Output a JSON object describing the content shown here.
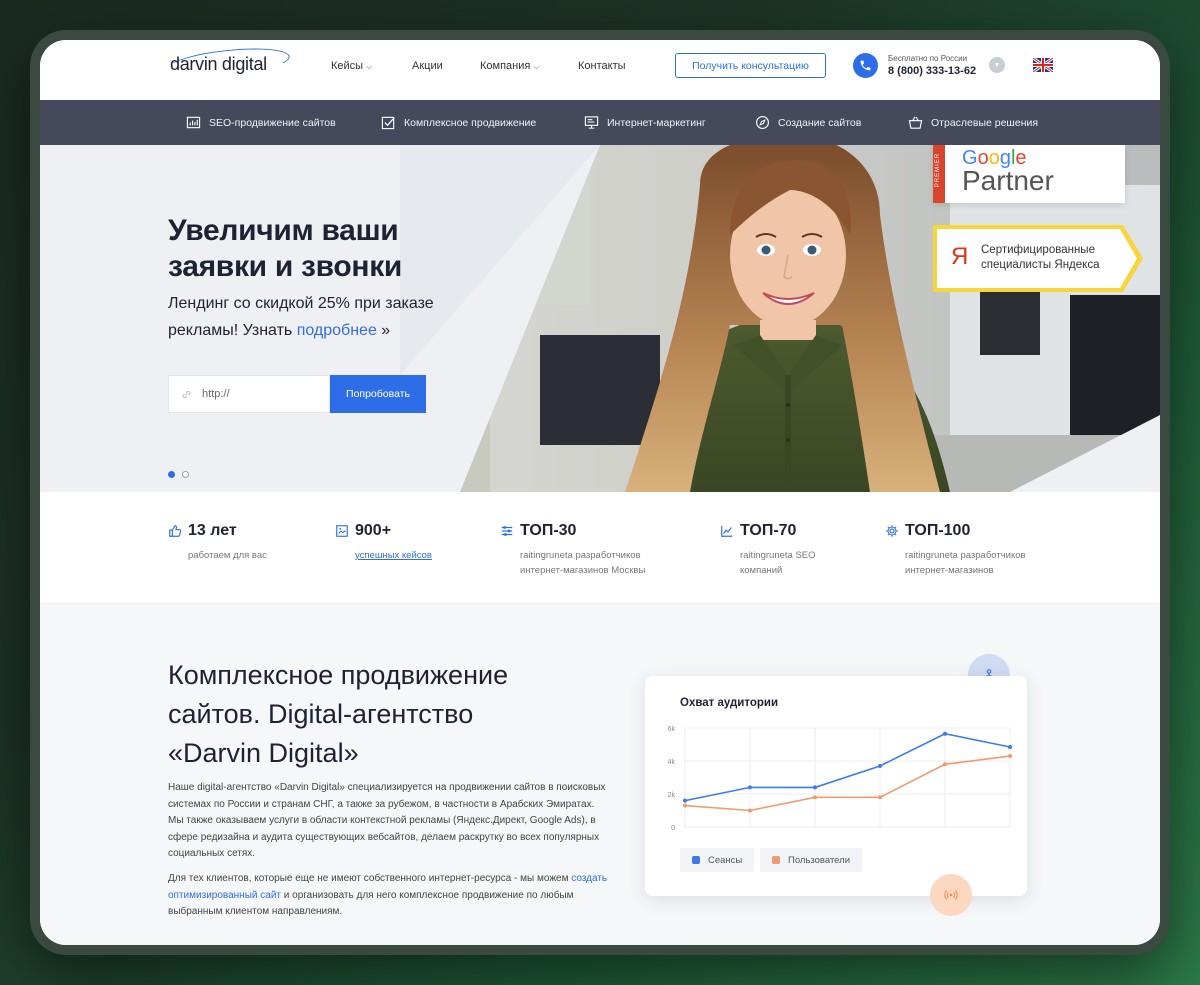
{
  "header": {
    "logo": "darvin digital",
    "nav": [
      {
        "label": "Кейсы",
        "dropdown": true
      },
      {
        "label": "Акции",
        "dropdown": false
      },
      {
        "label": "Компания",
        "dropdown": true
      },
      {
        "label": "Контакты",
        "dropdown": false
      }
    ],
    "consult_button": "Получить консультацию",
    "phone_caption": "Бесплатно по России",
    "phone_number": "8 (800) 333-13-62"
  },
  "subnav": [
    {
      "label": "SEO-продвижение сайтов",
      "icon": "chart-icon"
    },
    {
      "label": "Комплексное продвижение",
      "icon": "checkbox-icon"
    },
    {
      "label": "Интернет-маркетинг",
      "icon": "presentation-icon"
    },
    {
      "label": "Создание сайтов",
      "icon": "compass-icon"
    },
    {
      "label": "Отраслевые решения",
      "icon": "basket-icon"
    }
  ],
  "hero": {
    "title_line1": "Увеличим ваши",
    "title_line2": "заявки и звонки",
    "subtitle_text": "Лендинг со скидкой 25% при заказе рекламы! Узнать ",
    "subtitle_link": "подробнее",
    "subtitle_after": " »",
    "url_placeholder": "http://",
    "try_button": "Попробовать",
    "slides_total": 2,
    "slide_active": 1
  },
  "badges": {
    "google_premier": "PREMIER",
    "google_word": "Google",
    "google_partner": "Partner",
    "yandex_letter": "Я",
    "yandex_line1": "Сертифицированные",
    "yandex_line2": "специалисты Яндекса"
  },
  "stats": [
    {
      "value": "13 лет",
      "desc": [
        "работаем для вас"
      ],
      "icon": "thumbs-up-icon",
      "link": false
    },
    {
      "value": "900+",
      "desc": [
        "успешных кейсов"
      ],
      "icon": "image-icon",
      "link": true
    },
    {
      "value": "ТОП-30",
      "desc": [
        "raitingruneta разработчиков",
        "интернет-магазинов Москвы"
      ],
      "icon": "sliders-icon",
      "link": false
    },
    {
      "value": "ТОП-70",
      "desc": [
        "raitingruneta SEO",
        "компаний"
      ],
      "icon": "line-chart-icon",
      "link": false
    },
    {
      "value": "ТОП-100",
      "desc": [
        "raitingruneta разработчиков",
        "интернет-магазинов"
      ],
      "icon": "gear-icon",
      "link": false
    }
  ],
  "about": {
    "title_line1": "Комплексное продвижение",
    "title_line2": "сайтов. Digital-агентство",
    "title_line3": "«Darvin Digital»",
    "para1": "Наше digital-агентство «Darvin Digital» специализируется на продвижении сайтов в поисковых системах по России и странам СНГ, а также за рубежом, в частности в Арабских Эмиратах. Мы также оказываем услуги в области контекстной рекламы (Яндекс.Директ, Google Ads), в сфере редизайна и аудита существующих вебсайтов, делаем раскрутку во всех популярных социальных сетях.",
    "para2_before": "Для тех клиентов, которые еще не имеют собственного интернет-ресурса - мы можем ",
    "para2_link": "создать оптимизированный сайт",
    "para2_after": " и организовать для него комплексное продвижение по любым выбранным клиентом направлениям."
  },
  "chart_data": {
    "type": "line",
    "title": "Охват аудитории",
    "y_ticks": [
      "0",
      "2k",
      "4k",
      "6k"
    ],
    "ylim": [
      0,
      6000
    ],
    "x": [
      0,
      1,
      2,
      3,
      4,
      5
    ],
    "series": [
      {
        "name": "Сеансы",
        "color": "#3b7bea",
        "values": [
          1600,
          2400,
          2400,
          3700,
          5650,
          4850
        ]
      },
      {
        "name": "Пользователи",
        "color": "#f19a6b",
        "values": [
          1300,
          1000,
          1800,
          1800,
          3800,
          4300
        ]
      }
    ],
    "grid": true,
    "legend": "bottom"
  },
  "colors": {
    "accent": "#2d6ee8",
    "subnav_bg": "#44495c",
    "yandex_yellow": "#f8d53a",
    "yandex_red": "#e1321b"
  }
}
